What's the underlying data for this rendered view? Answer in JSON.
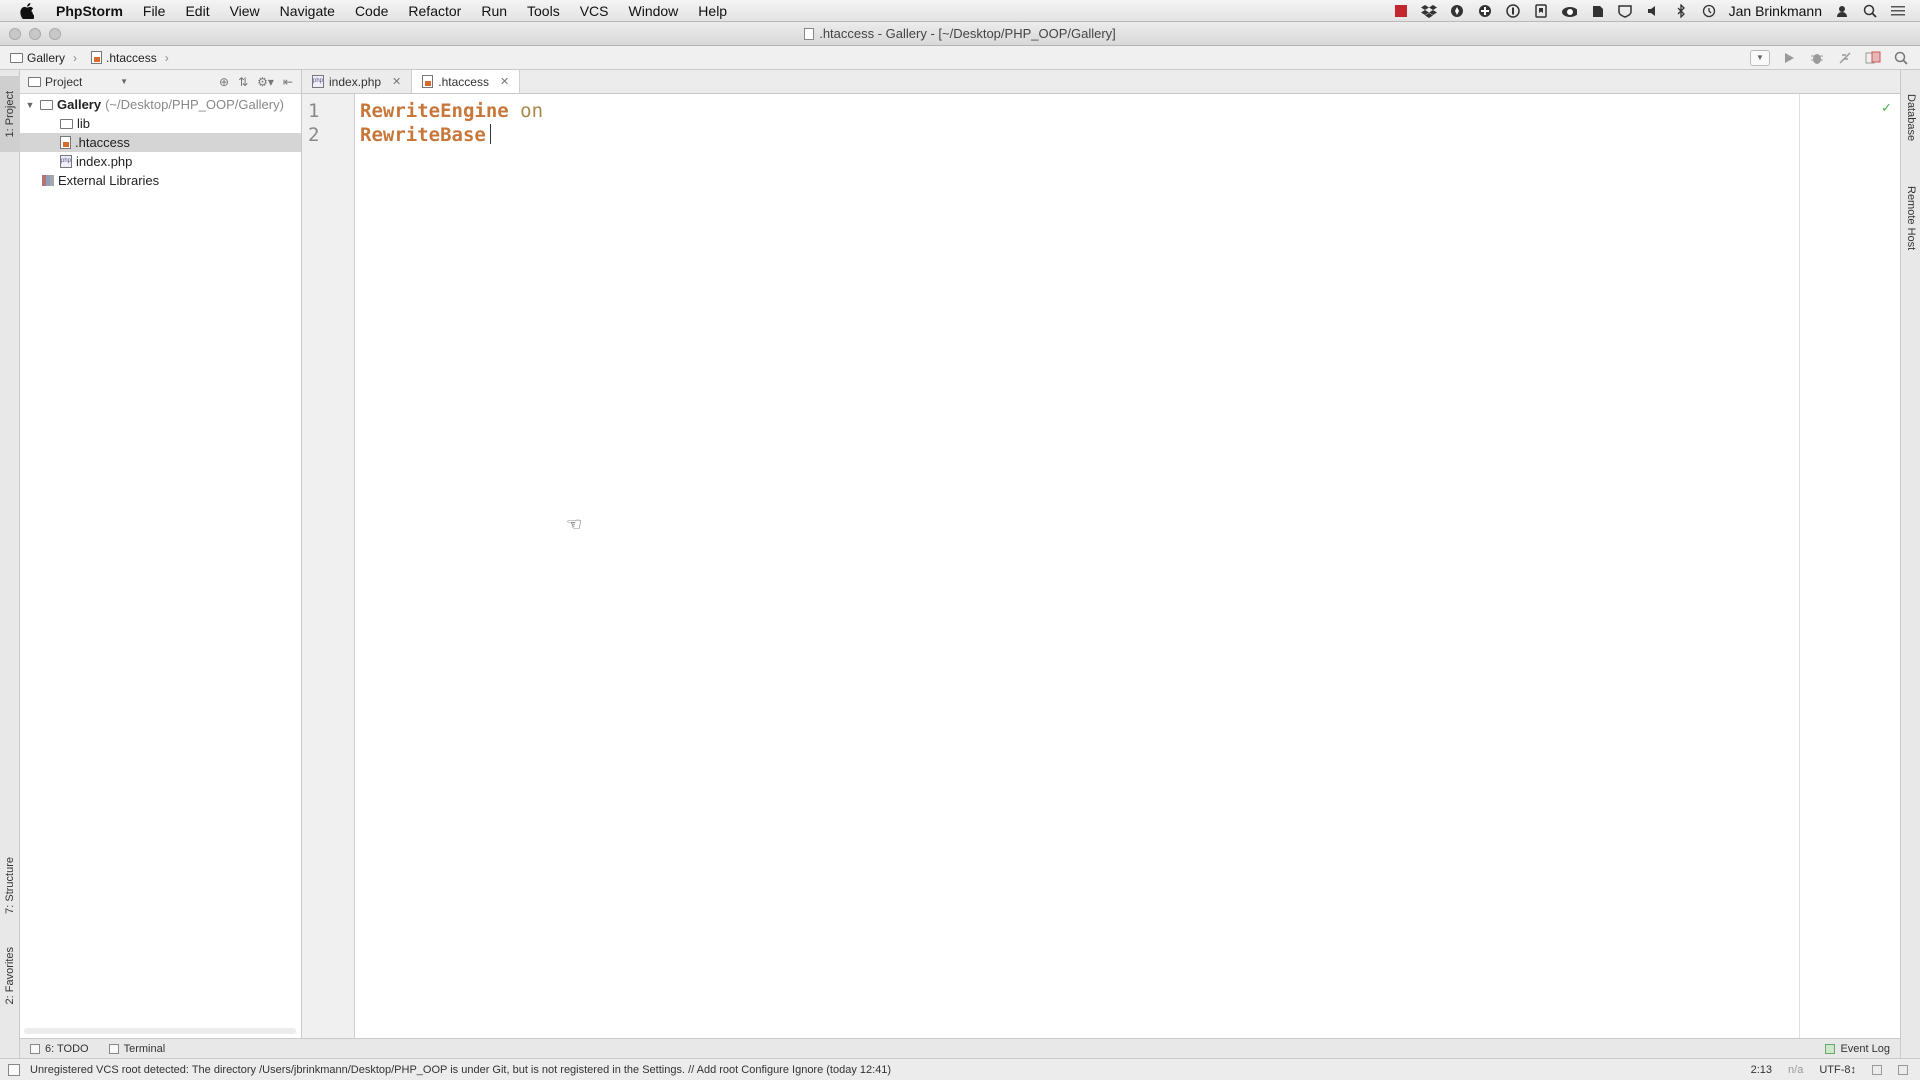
{
  "menubar": {
    "app_name": "PhpStorm",
    "items": [
      "File",
      "Edit",
      "View",
      "Navigate",
      "Code",
      "Refactor",
      "Run",
      "Tools",
      "VCS",
      "Window",
      "Help"
    ],
    "user": "Jan Brinkmann"
  },
  "window": {
    "title": ".htaccess - Gallery - [~/Desktop/PHP_OOP/Gallery]"
  },
  "navbar": {
    "breadcrumbs": [
      "Gallery",
      ".htaccess"
    ]
  },
  "left_strip": {
    "project_tab": "1: Project",
    "structure_tab": "7: Structure",
    "favorites_tab": "2: Favorites"
  },
  "right_strip": {
    "database_tab": "Database",
    "remote_tab": "Remote Host"
  },
  "project_panel": {
    "view_label": "Project",
    "tree": {
      "root_name": "Gallery",
      "root_path": "(~/Desktop/PHP_OOP/Gallery)",
      "lib": "lib",
      "htaccess": ".htaccess",
      "index": "index.php",
      "external": "External Libraries"
    }
  },
  "editor": {
    "tabs": [
      ".htaccess"
    ],
    "tab_index": "index.php",
    "tab_htaccess": ".htaccess",
    "lines": [
      {
        "no": "1",
        "directive": "RewriteEngine",
        "value": "on"
      },
      {
        "no": "2",
        "directive": "RewriteBase",
        "value": ""
      }
    ]
  },
  "bottom_tabs": {
    "todo": "6: TODO",
    "terminal": "Terminal",
    "event_log": "Event Log"
  },
  "statusbar": {
    "message": "Unregistered VCS root detected: The directory /Users/jbrinkmann/Desktop/PHP_OOP is under Git, but is not registered in the Settings. // Add root  Configure  Ignore (today 12:41)",
    "position": "2:13",
    "na": "n/a",
    "encoding": "UTF-8↕"
  },
  "colors": {
    "keyword": "#c8773a",
    "value": "#a7874b",
    "ok": "#4caf50"
  }
}
